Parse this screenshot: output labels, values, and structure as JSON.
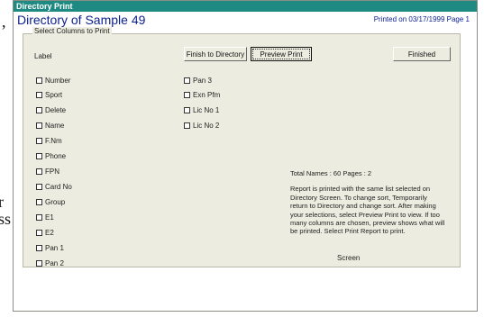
{
  "document": {
    "side_texts": [
      ",",
      "r",
      "ss"
    ]
  },
  "window": {
    "title": "Directory Print",
    "heading": "Directory of Sample 49",
    "printed_on": "Printed on 03/17/1999 Page 1"
  },
  "panel": {
    "legend": "Select Columns to Print",
    "label": "Label",
    "buttons": {
      "finish_directory": "Finish to Directory",
      "preview_print": "Preview Print",
      "finished": "Finished"
    },
    "columns_left": [
      "Number",
      "Sport",
      "Delete",
      "Name",
      "F.Nm",
      "Phone",
      "FPN",
      "Card No",
      "Group",
      "E1",
      "E2",
      "Pan 1",
      "Pan 2"
    ],
    "columns_right": [
      "Pan 3",
      "Exn Pfm",
      "Lic No 1",
      "Lic No 2"
    ],
    "info": {
      "totals": "Total Names : 60  Pages : 2",
      "description": "Report is printed with the same list selected on Directory Screen. To change sort, Temporarily return to Directory and change sort. After making your selections, select Preview Print to view. If too many columns are chosen, preview shows what will be printed. Select Print Report to print."
    },
    "screen_label": "Screen"
  },
  "colors": {
    "titlebar": "#1f8a82",
    "heading": "#0a1f8f",
    "panel": "#ecece0"
  }
}
